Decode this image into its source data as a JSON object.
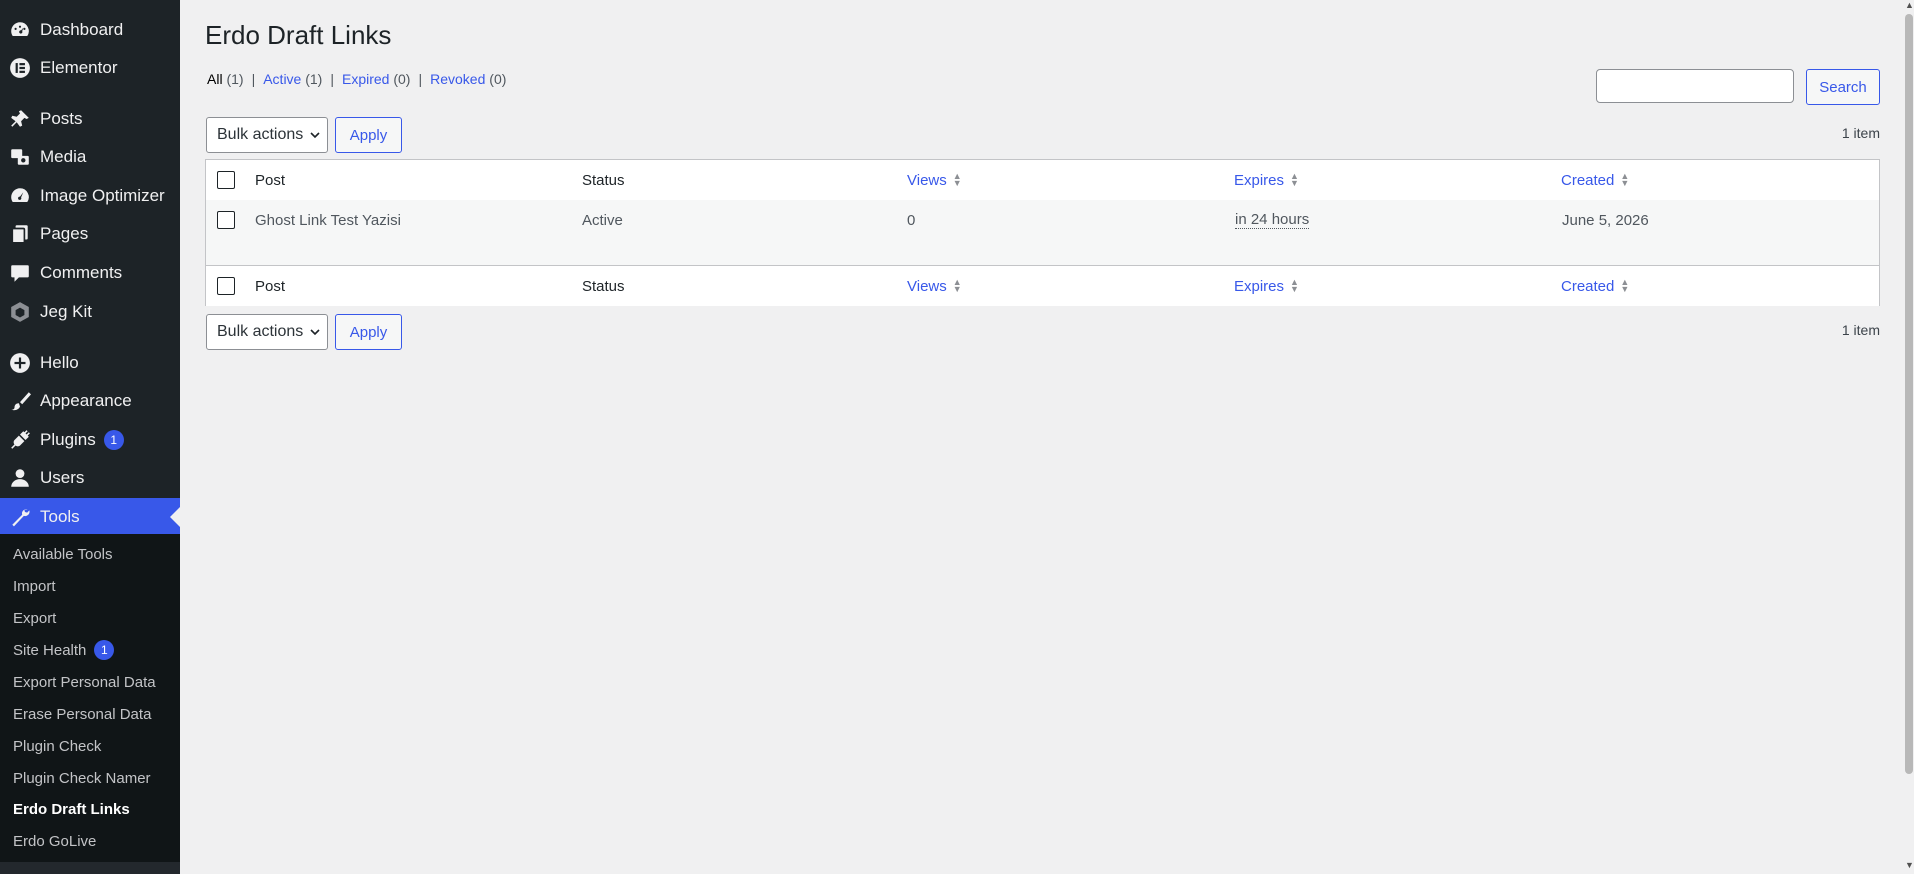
{
  "sidebar": {
    "items": [
      {
        "label": "Dashboard",
        "icon": "dashboard-icon"
      },
      {
        "label": "Elementor",
        "icon": "elementor-icon"
      },
      {
        "label": "Posts",
        "icon": "pin-icon"
      },
      {
        "label": "Media",
        "icon": "media-icon"
      },
      {
        "label": "Image Optimizer",
        "icon": "gauge-icon"
      },
      {
        "label": "Pages",
        "icon": "pages-icon"
      },
      {
        "label": "Comments",
        "icon": "comment-icon"
      },
      {
        "label": "Jeg Kit",
        "icon": "hexagon-icon"
      },
      {
        "label": "Hello",
        "icon": "plus-circle-icon"
      },
      {
        "label": "Appearance",
        "icon": "brush-icon"
      },
      {
        "label": "Plugins",
        "icon": "plug-icon",
        "badge": "1"
      },
      {
        "label": "Users",
        "icon": "user-icon"
      },
      {
        "label": "Tools",
        "icon": "wrench-icon"
      }
    ],
    "submenu": [
      {
        "label": "Available Tools"
      },
      {
        "label": "Import"
      },
      {
        "label": "Export"
      },
      {
        "label": "Site Health",
        "badge": "1"
      },
      {
        "label": "Export Personal Data"
      },
      {
        "label": "Erase Personal Data"
      },
      {
        "label": "Plugin Check"
      },
      {
        "label": "Plugin Check Namer"
      },
      {
        "label": "Erdo Draft Links"
      },
      {
        "label": "Erdo GoLive"
      }
    ]
  },
  "page": {
    "title": "Erdo Draft Links",
    "filters": {
      "all_label": "All",
      "all_count": "(1)",
      "active_label": "Active",
      "active_count": "(1)",
      "expired_label": "Expired",
      "expired_count": "(0)",
      "revoked_label": "Revoked",
      "revoked_count": "(0)",
      "separator": "|"
    },
    "search": {
      "button": "Search",
      "value": ""
    },
    "bulk": {
      "label": "Bulk actions",
      "apply": "Apply"
    },
    "item_count": "1 item"
  },
  "table": {
    "columns": {
      "post": "Post",
      "status": "Status",
      "views": "Views",
      "expires": "Expires",
      "created": "Created"
    },
    "rows": [
      {
        "post": "Ghost Link Test Yazisi",
        "status": "Active",
        "views": "0",
        "expires": "in 24 hours",
        "created": "June 5, 2026"
      }
    ]
  },
  "colors": {
    "accent": "#3858e9",
    "sidebar": "#1d2327",
    "background": "#f0f0f1"
  }
}
